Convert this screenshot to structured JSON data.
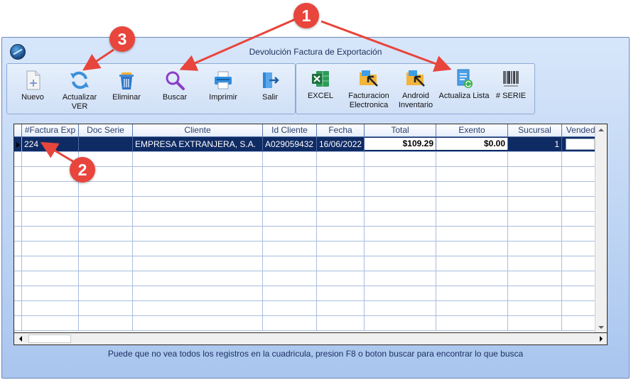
{
  "window": {
    "title": "Devolución  Factura de  Exportación"
  },
  "toolbar_left": [
    {
      "label": "Nuevo",
      "icon": "new-document-icon"
    },
    {
      "label": "Actualizar VER",
      "icon": "refresh-icon"
    },
    {
      "label": "Eliminar",
      "icon": "trash-icon"
    },
    {
      "label": "Buscar",
      "icon": "search-icon"
    },
    {
      "label": "Imprimir",
      "icon": "printer-icon"
    },
    {
      "label": "Salir",
      "icon": "exit-icon"
    }
  ],
  "toolbar_right": [
    {
      "label": "EXCEL",
      "icon": "excel-icon"
    },
    {
      "label": "Facturacion Electronica",
      "icon": "folder-arrow-icon"
    },
    {
      "label": "Android Inventario",
      "icon": "folder-arrow-icon"
    },
    {
      "label": "Actualiza Lista",
      "icon": "update-list-icon"
    },
    {
      "label": "# SERIE",
      "icon": "barcode-icon"
    }
  ],
  "grid": {
    "columns": [
      "#Factura Exp",
      "Doc Serie",
      "Cliente",
      "Id Cliente",
      "Fecha",
      "Total",
      "Exento",
      "Sucursal",
      "Vendedor"
    ],
    "rows": [
      [
        "224",
        "",
        "EMPRESA EXTRANJERA, S.A.",
        "A029059432",
        "16/06/2022",
        "$109.29",
        "$0.00",
        "1",
        ""
      ]
    ],
    "empty_rows": 12
  },
  "status": {
    "hint": "Puede que no vea todos los registros en la cuadricula, presion F8 o boton buscar para encontrar lo que busca"
  },
  "annotations": [
    {
      "label": "1"
    },
    {
      "label": "2"
    },
    {
      "label": "3"
    }
  ],
  "colors": {
    "selected_row": "#0f2b64",
    "badge": "#e8453c",
    "window_bg": "#bcd3f3"
  }
}
